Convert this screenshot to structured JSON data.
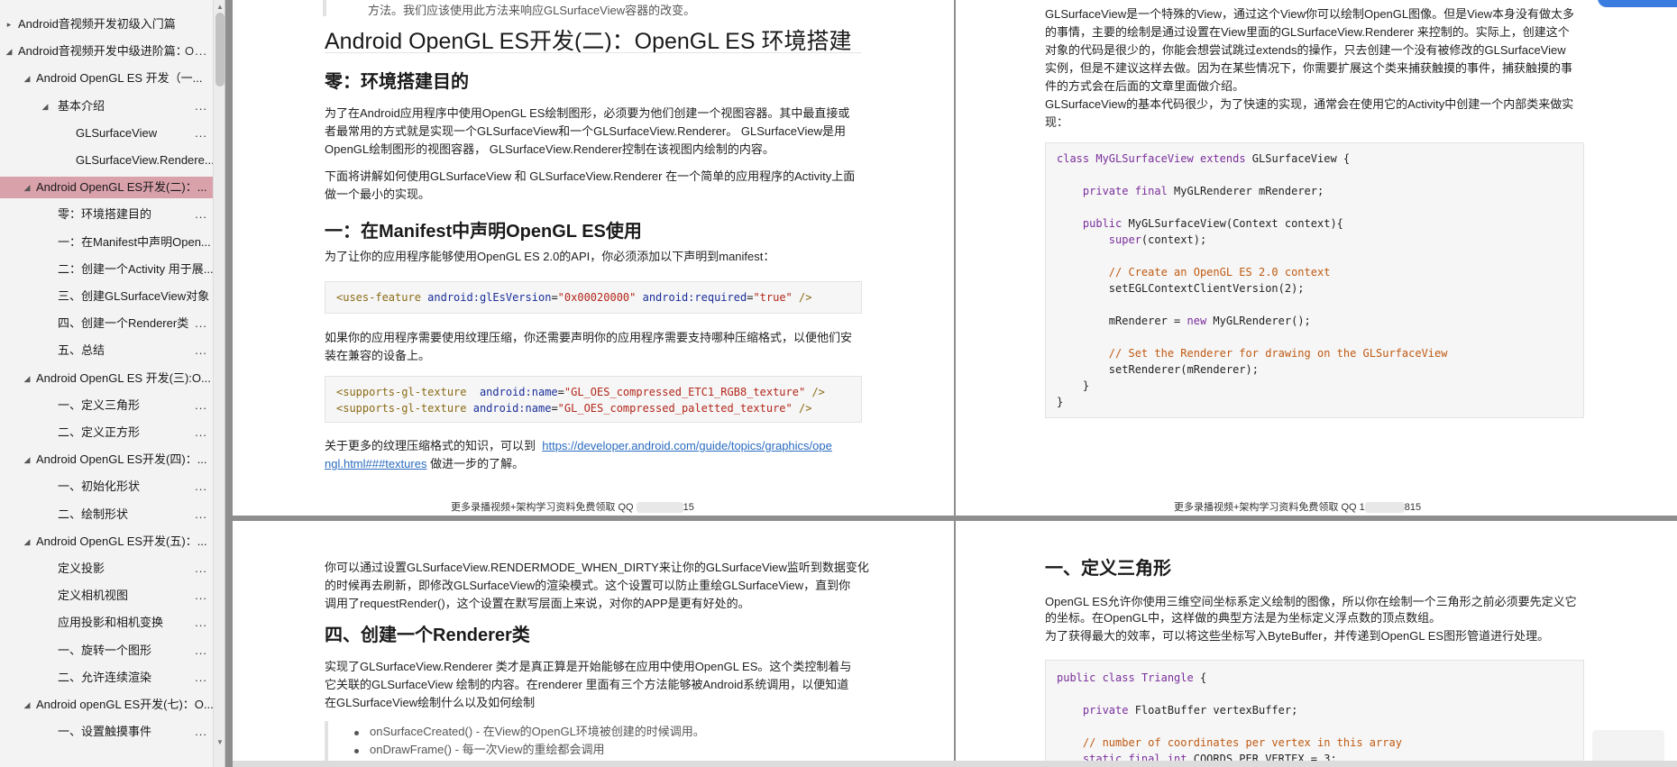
{
  "sidebar": {
    "items": [
      {
        "label": "Android音视频开发初级入门篇",
        "arrow": "▸",
        "dots": ""
      },
      {
        "label": "Android音视频开发中级进阶篇：",
        "arrow": "◢",
        "dots": "O..."
      },
      {
        "label": "Android OpenGL ES 开发（一...",
        "arrow": "◢",
        "dots": ""
      },
      {
        "label": "基本介绍",
        "arrow": "◢",
        "dots": "..."
      },
      {
        "label": "GLSurfaceView",
        "arrow": "",
        "dots": "..."
      },
      {
        "label": "GLSurfaceView.Rendere...",
        "arrow": "",
        "dots": ""
      },
      {
        "label": "Android OpenGL ES开发(二)：...",
        "arrow": "◢",
        "dots": ""
      },
      {
        "label": "零：环境搭建目的",
        "arrow": "",
        "dots": "..."
      },
      {
        "label": "一：在Manifest中声明Open...",
        "arrow": "",
        "dots": ""
      },
      {
        "label": "二：创建一个Activity 用于展...",
        "arrow": "",
        "dots": ""
      },
      {
        "label": "三、创建GLSurfaceView对象",
        "arrow": "",
        "dots": ""
      },
      {
        "label": "四、创建一个Renderer类",
        "arrow": "",
        "dots": "..."
      },
      {
        "label": "五、总结",
        "arrow": "",
        "dots": "..."
      },
      {
        "label": "Android OpenGL ES 开发(三):O...",
        "arrow": "◢",
        "dots": ""
      },
      {
        "label": "一、定义三角形",
        "arrow": "",
        "dots": "..."
      },
      {
        "label": "二、定义正方形",
        "arrow": "",
        "dots": "..."
      },
      {
        "label": "Android OpenGL ES开发(四)：...",
        "arrow": "◢",
        "dots": ""
      },
      {
        "label": "一、初始化形状",
        "arrow": "",
        "dots": "..."
      },
      {
        "label": "二、绘制形状",
        "arrow": "",
        "dots": "..."
      },
      {
        "label": "Android OpenGL ES开发(五)：...",
        "arrow": "◢",
        "dots": ""
      },
      {
        "label": "定义投影",
        "arrow": "",
        "dots": "..."
      },
      {
        "label": "定义相机视图",
        "arrow": "",
        "dots": "..."
      },
      {
        "label": "应用投影和相机变换",
        "arrow": "",
        "dots": "..."
      },
      {
        "label": "一、旋转一个图形",
        "arrow": "",
        "dots": "..."
      },
      {
        "label": "二、允许连续渲染",
        "arrow": "",
        "dots": "..."
      },
      {
        "label": "Android openGL ES开发(七)：O...",
        "arrow": "◢",
        "dots": ""
      },
      {
        "label": "一、设置触摸事件",
        "arrow": "",
        "dots": "..."
      }
    ]
  },
  "page1": {
    "top_text": "方法。我们应该使用此方法来响应GLSurfaceView容器的改变。",
    "title": "Android OpenGL ES开发(二)：OpenGL ES 环境搭建",
    "h_zero": "零：环境搭建目的",
    "p1_l1": "为了在Android应用程序中使用OpenGL ES绘制图形，必须要为他们创建一个视图容器。其中最直接或",
    "p1_l2": "者最常用的方式就是实现一个GLSurfaceView和一个GLSurfaceView.Renderer。 GLSurfaceView是用",
    "p1_l3": "OpenGL绘制图形的视图容器，   GLSurfaceView.Renderer控制在该视图内绘制的内容。",
    "p2_l1": "下面将讲解如何使用GLSurfaceView 和 GLSurfaceView.Renderer 在一个简单的应用程序的Activity上面",
    "p2_l2": "做一个最小的实现。",
    "h_one": "一：在Manifest中声明OpenGL ES使用",
    "p3": "为了让你的应用程序能够使用OpenGL ES 2.0的API，你必须添加以下声明到manifest：",
    "p4_l1": "如果你的应用程序需要使用纹理压缩，你还需要声明你的应用程序需要支持哪种压缩格式，以便他们安",
    "p4_l2": "装在兼容的设备上。",
    "p5_l1": "关于更多的纹理压缩格式的知识，可以到",
    "link_l1": "https://developer.android.com/guide/topics/graphics/ope",
    "link_l2": "ngl.html###textures",
    "p5_tail": "做进一步的了解。",
    "footer_left": "更多录播视频+架构学习资料免费领取  QQ",
    "footer_right": "15"
  },
  "page2": {
    "l1": "GLSurfaceView是一个特殊的View，通过这个View你可以绘制OpenGL图像。但是View本身没有做太多",
    "l2": "的事情，主要的绘制是通过设置在View里面的GLSurfaceView.Renderer 来控制的。实际上，创建这个",
    "l3": "对象的代码是很少的，你能会想尝试跳过extends的操作，只去创建一个没有被修改的GLSurfaceView",
    "l4": "实例，但是不建议这样去做。因为在某些情况下，你需要扩展这个类来捕获触摸的事件，捕获触摸的事",
    "l5": "件的方式会在后面的文章里面做介绍。",
    "l6": "GLSurfaceView的基本代码很少，为了快速的实现，通常会在使用它的Activity中创建一个内部类来做实",
    "l7": "现：",
    "footer_left": "更多录播视频+架构学习资料免费领取  QQ   1",
    "footer_right": "815"
  },
  "page3": {
    "p1_l1": "你可以通过设置GLSurfaceView.RENDERMODE_WHEN_DIRTY来让你的GLSurfaceView监听到数据变化",
    "p1_l2": "的时候再去刷新，即修改GLSurfaceView的渲染模式。这个设置可以防止重绘GLSurfaceView，直到你",
    "p1_l3": "调用了requestRender()，这个设置在默写层面上来说，对你的APP是更有好处的。",
    "h_four": "四、创建一个Renderer类",
    "p2_l1": "实现了GLSurfaceView.Renderer 类才是真正算是开始能够在应用中使用OpenGL ES。这个类控制着与",
    "p2_l2": "它关联的GLSurfaceView 绘制的内容。在renderer 里面有三个方法能够被Android系统调用，以便知道",
    "p2_l3": "在GLSurfaceView绘制什么以及如何绘制",
    "b1": "onSurfaceCreated() - 在View的OpenGL环境被创建的时候调用。",
    "b2": "onDrawFrame() - 每一次View的重绘都会调用"
  },
  "page4": {
    "h_one": "一、定义三角形",
    "p1_l1": "OpenGL ES允许你使用三维空间坐标系定义绘制的图像，所以你在绘制一个三角形之前必须要先定义它",
    "p1_l2": "的坐标。在OpenGL中，这样做的典型方法是为坐标定义浮点数的顶点数组。",
    "p2": "为了获得最大的效率，可以将这些坐标写入ByteBuffer，并传递到OpenGL ES图形管道进行处理。"
  }
}
